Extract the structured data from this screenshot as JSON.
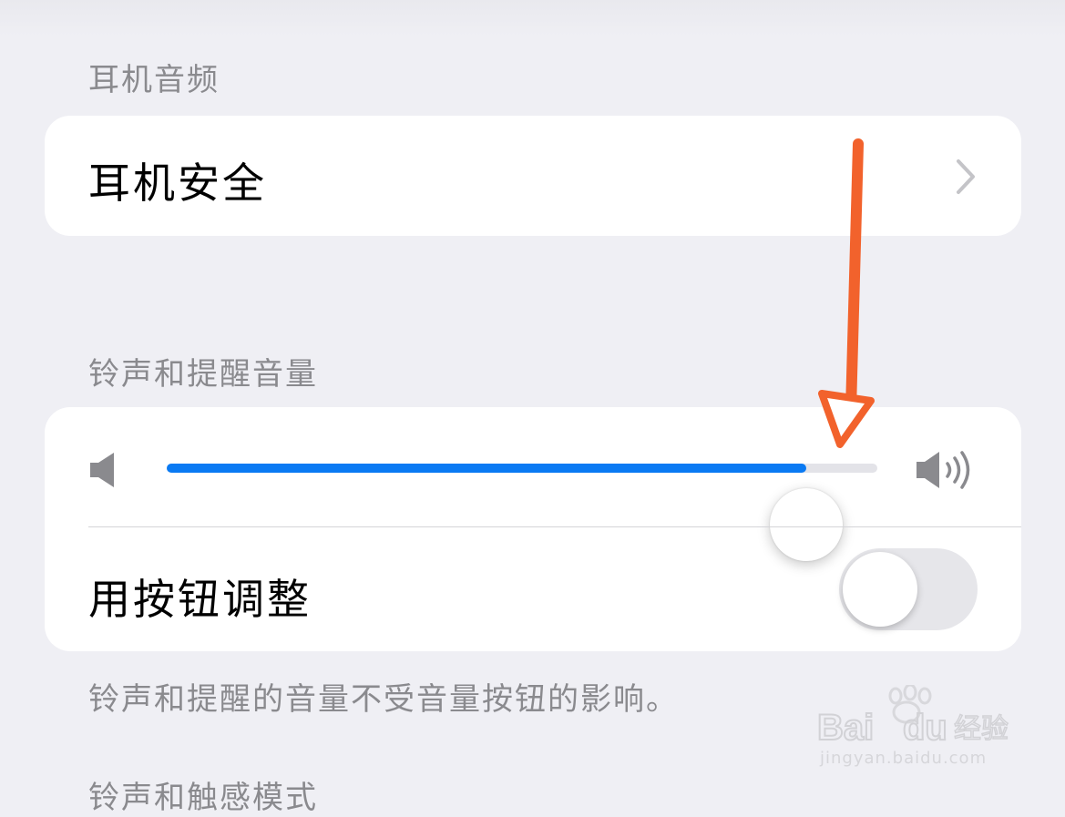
{
  "headphone_section": {
    "header": "耳机音频",
    "headphone_safety_label": "耳机安全"
  },
  "ringer_section": {
    "header": "铃声和提醒音量",
    "volume_level_percent": 90,
    "change_with_buttons_label": "用按钮调整",
    "change_with_buttons_on": false,
    "footer": "铃声和提醒的音量不受音量按钮的影响。"
  },
  "next_section": {
    "header": "铃声和触感模式"
  },
  "watermark": {
    "brand": "Baidu经验",
    "url": "jingyan.baidu.com"
  },
  "colors": {
    "background": "#efeff4",
    "accent": "#0a7af3",
    "annotation_arrow": "#f2622c"
  },
  "icons": [
    "chevron-right-icon",
    "speaker-low-icon",
    "speaker-high-icon",
    "annotation-arrow-icon"
  ]
}
